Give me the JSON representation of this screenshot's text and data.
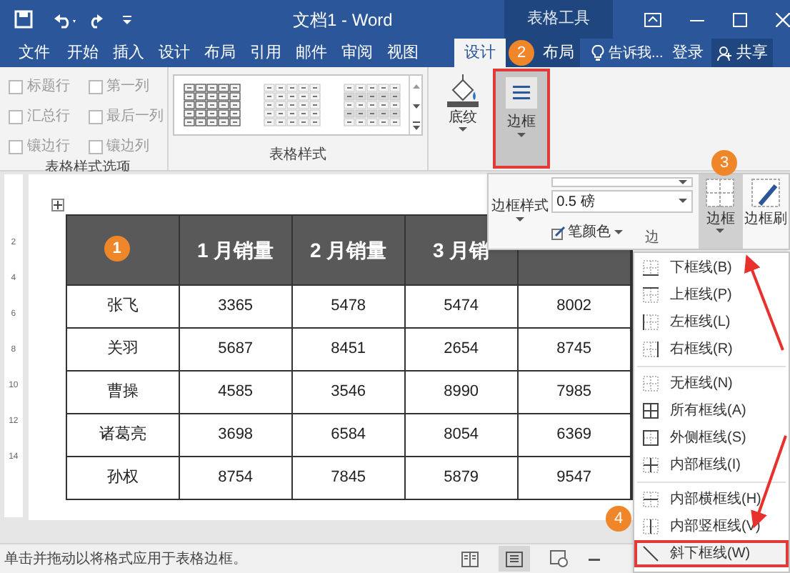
{
  "title_bar": {
    "title": "文档1 - Word",
    "context_label": "表格工具"
  },
  "tabs": [
    {
      "label": "文件",
      "selected": false
    },
    {
      "label": "开始",
      "selected": false
    },
    {
      "label": "插入",
      "selected": false
    },
    {
      "label": "设计",
      "selected": false
    },
    {
      "label": "布局",
      "selected": false
    },
    {
      "label": "引用",
      "selected": false
    },
    {
      "label": "邮件",
      "selected": false
    },
    {
      "label": "审阅",
      "selected": false
    },
    {
      "label": "视图",
      "selected": false
    }
  ],
  "context_tabs": [
    {
      "label": "设计",
      "selected": true
    },
    {
      "label": "布局",
      "selected": false
    }
  ],
  "tell_me": "告诉我...",
  "sign_in": "登录",
  "share": "共享",
  "ribbon": {
    "options": [
      {
        "label": "标题行",
        "checked": false
      },
      {
        "label": "第一列",
        "checked": false
      },
      {
        "label": "汇总行",
        "checked": false
      },
      {
        "label": "最后一列",
        "checked": false
      },
      {
        "label": "镶边行",
        "checked": false
      },
      {
        "label": "镶边列",
        "checked": false
      }
    ],
    "options_group": "表格样式选项",
    "styles_group": "表格样式",
    "shading": "底纹",
    "borders": {
      "label": "边框",
      "selected": true
    }
  },
  "borders_panel": {
    "style_button": "边框样式",
    "line_weight": "0.5 磅",
    "pen_color": "笔颜色",
    "group_label": "边",
    "border_button": "边框",
    "painter": "边框刷"
  },
  "ruler": [
    "2",
    "4",
    "6",
    "8",
    "10",
    "12",
    "14"
  ],
  "table": {
    "header": [
      "1 月销量",
      "2 月销量",
      "3 月销"
    ],
    "rows": [
      [
        "张飞",
        "3365",
        "5478",
        "5474",
        "8002"
      ],
      [
        "关羽",
        "5687",
        "8451",
        "2654",
        "8745"
      ],
      [
        "曹操",
        "4585",
        "3546",
        "8990",
        "7985"
      ],
      [
        "诸葛亮",
        "3698",
        "6584",
        "8054",
        "6369"
      ],
      [
        "孙权",
        "8754",
        "7845",
        "5879",
        "9547"
      ]
    ]
  },
  "border_menu": {
    "groups": [
      [
        {
          "label": "下框线(B)",
          "kind": "bottom",
          "selected": false
        },
        {
          "label": "上框线(P)",
          "kind": "top",
          "selected": false
        },
        {
          "label": "左框线(L)",
          "kind": "left",
          "selected": false
        },
        {
          "label": "右框线(R)",
          "kind": "right",
          "selected": false
        }
      ],
      [
        {
          "label": "无框线(N)",
          "kind": "none",
          "selected": false
        },
        {
          "label": "所有框线(A)",
          "kind": "all",
          "selected": false
        },
        {
          "label": "外侧框线(S)",
          "kind": "outside",
          "selected": false
        },
        {
          "label": "内部框线(I)",
          "kind": "inside",
          "selected": false
        }
      ],
      [
        {
          "label": "内部横框线(H)",
          "kind": "inside_h",
          "selected": false
        },
        {
          "label": "内部竖框线(V)",
          "kind": "inside_v",
          "selected": false
        },
        {
          "label": "斜下框线(W)",
          "kind": "diag_down",
          "selected": true
        }
      ]
    ]
  },
  "steps": [
    "1",
    "2",
    "3",
    "4"
  ],
  "status_bar": {
    "text": "单击并拖动以将格式应用于表格边框。"
  }
}
